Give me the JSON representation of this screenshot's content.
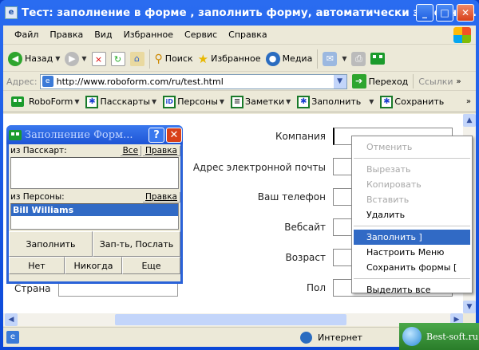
{
  "window": {
    "title": "Тест: заполнение в форме , заполнить форму, автоматически заполни..."
  },
  "menu": [
    "Файл",
    "Правка",
    "Вид",
    "Избранное",
    "Сервис",
    "Справка"
  ],
  "toolbar": {
    "back": "Назад",
    "search": "Поиск",
    "favorites": "Избранное",
    "media": "Медиа"
  },
  "address": {
    "label": "Адрес:",
    "url": "http://www.roboform.com/ru/test.html",
    "go": "Переход",
    "links": "Ссылки"
  },
  "roboform_bar": [
    "RoboForm",
    "Пасскарты",
    "Персоны",
    "Заметки",
    "Заполнить",
    "Сохранить"
  ],
  "form": {
    "fields": [
      "Компания",
      "Адрес электронной почты",
      "Ваш телефон",
      "Вебсайт",
      "Возраст",
      "Пол"
    ],
    "country": "Страна"
  },
  "context_menu": {
    "items": [
      {
        "label": "Отменить",
        "disabled": true
      },
      {
        "label": "Вырезать",
        "disabled": true
      },
      {
        "label": "Копировать",
        "disabled": true
      },
      {
        "label": "Вставить",
        "disabled": true
      },
      {
        "label": "Удалить",
        "disabled": false
      },
      {
        "label": "Заполнить ]",
        "selected": true
      },
      {
        "label": "Настроить Меню"
      },
      {
        "label": "Сохранить формы ["
      },
      {
        "label": "Выделить все"
      }
    ]
  },
  "dialog": {
    "title": "Заполнение Форм...",
    "passcards_label": "из Пасскарт:",
    "all": "Все",
    "edit": "Правка",
    "identities_label": "из Персоны:",
    "identity": "Bill Williams",
    "fill": "Заполнить",
    "fill_submit": "Зап-ть, Послать",
    "no": "Нет",
    "never": "Никогда",
    "more": "Еще"
  },
  "status": {
    "zone": "Интернет"
  },
  "watermark": "Best-soft.ru"
}
